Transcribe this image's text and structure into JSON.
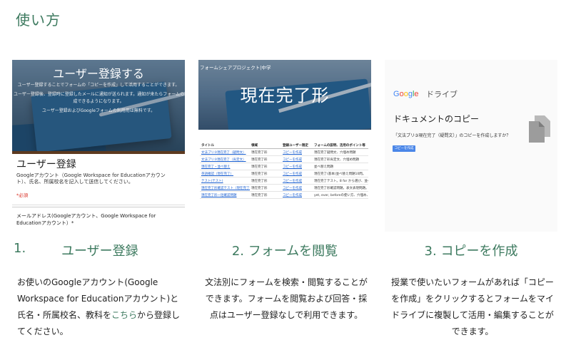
{
  "page": {
    "title": "使い方"
  },
  "card1": {
    "hero_title": "ユーザー登録する",
    "hero_line1": "ユーザー登録することでフォームの「コピーを作成」して活用することができます。",
    "hero_line2": "ユーザー登録後、登録時に登録したメールに通知が送られます。通知が来たらフォームのコピー",
    "hero_line3": "成できるようになります。",
    "hero_line4": "ユーザー登録およびGoogleフォームの利用用は無料です。",
    "form_title": "ユーザー登録",
    "form_desc": "Googleアカウント（Google Workspace for Educationアカウント）、氏名、所属校名を記入して送信してください。",
    "required": "*必須",
    "question": "メールアドレス(Googleアカウント、Google Workspace for Educationアカウント）*"
  },
  "card2": {
    "project": "フォームシェアプロジェクト|中学",
    "hero_title": "現在完了形",
    "table_headers": [
      "タイトル",
      "領域",
      "登録ユーザー限定",
      "フォームの説明、活用のポイント等"
    ],
    "rows": [
      [
        "文法プリ③現在完了（疑問文）",
        "現在完了形",
        "コピーを作成",
        "現在完了疑問文、穴埋め問題"
      ],
      [
        "文法プリ③現在完了（肯定文）",
        "現在完了形",
        "コピーを作成",
        "現在完了形肯定文、穴埋め問題"
      ],
      [
        "現在完了・並べ替え",
        "現在完了形",
        "コピーを作成",
        "並べ替え問題"
      ],
      [
        "英語確認（現在完了）",
        "現在完了形",
        "コピーを作成",
        "現在完了(基本)並べ替え問題10問。"
      ],
      [
        "テスト(テスト)",
        "現在完了形",
        "コピーを作成",
        "現在完了テスト。8 for から選び、並べ"
      ],
      [
        "現在完了形確認テスト（現在完了形）",
        "現在完了形",
        "コピーを作成",
        "現在完了形確認問題。表文表現問題。"
      ],
      [
        "現在完了形一括確認問題",
        "現在完了形",
        "コピーを作成",
        "yet, ever, beforeの使い方、穴埋め、日本"
      ]
    ]
  },
  "card3": {
    "logo": [
      "G",
      "o",
      "o",
      "g",
      "l",
      "e"
    ],
    "product": "ドライブ",
    "title": "ドキュメントのコピー",
    "message": "「文法プリ③現在完了（疑問文）」のコピーを作成しますか？",
    "button": "コピーを作成"
  },
  "steps": [
    {
      "num": "1.",
      "label": "ユーザー登録"
    },
    {
      "label": "2. フォームを閲覧"
    },
    {
      "label": "3. コピーを作成"
    }
  ],
  "descriptions": {
    "d1_before": "お使いのGoogleアカウント(Google Workspace for Educationアカウント)と氏名・所属校名、教科を",
    "d1_link": "こちら",
    "d1_after": "から登録してください。",
    "d2": "文法別にフォームを検索・閲覧することができます。フォームを閲覧および回答・採点はユーザー登録なしで利用できます。",
    "d3": "授業で使いたいフォームがあれば「コピーを作成」をクリックするとフォームをマイドライブに複製して活用・編集することができます。"
  },
  "colors": {
    "accent": "#3d7a5f",
    "link": "#1a5fd0",
    "drive_button": "#4a86e8"
  }
}
